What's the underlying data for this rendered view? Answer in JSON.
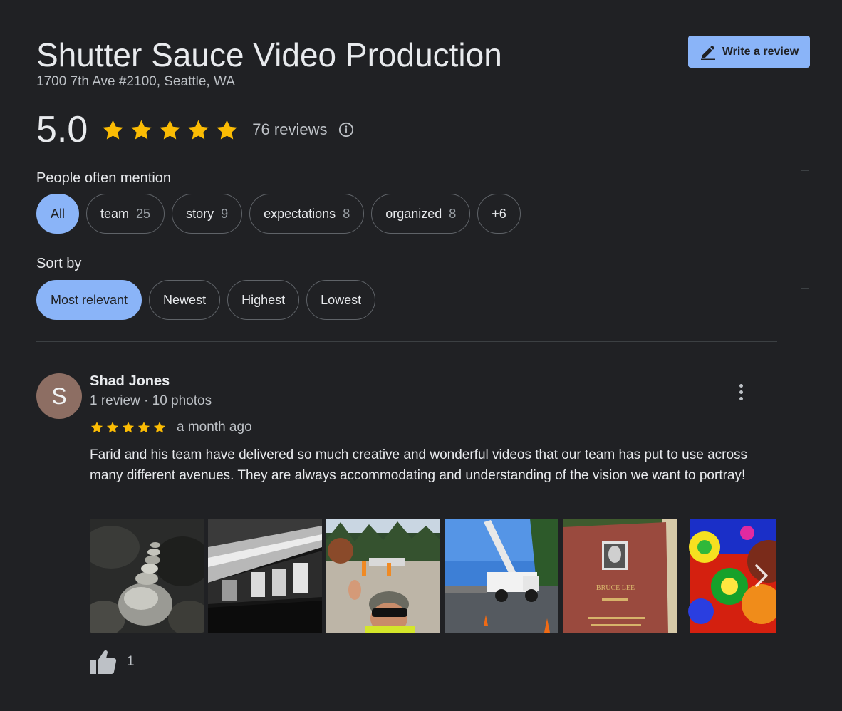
{
  "business": {
    "name": "Shutter Sauce Video Production",
    "address": "1700 7th Ave #2100, Seattle, WA"
  },
  "write_review": {
    "label": "Write a review",
    "icon": "pencil-icon"
  },
  "rating": {
    "value": "5.0",
    "stars": 5,
    "reviews_label": "76 reviews",
    "info_icon": "info-icon"
  },
  "mentions": {
    "label": "People often mention",
    "chips": [
      {
        "label": "All",
        "count": ""
      },
      {
        "label": "team",
        "count": "25"
      },
      {
        "label": "story",
        "count": "9"
      },
      {
        "label": "expectations",
        "count": "8"
      },
      {
        "label": "organized",
        "count": "8"
      },
      {
        "label": "+6",
        "count": ""
      }
    ]
  },
  "sort": {
    "label": "Sort by",
    "options": [
      "Most relevant",
      "Newest",
      "Highest",
      "Lowest"
    ],
    "selected": "Most relevant"
  },
  "review": {
    "avatar_letter": "S",
    "name": "Shad Jones",
    "meta": "1 review · 10 photos",
    "stars": 5,
    "date": "a month ago",
    "text": "Farid and his team have delivered so much creative and wonderful videos that our team has put to use across many different avenues.  They are always accommodating and understanding of the vision we want to portray!",
    "likes": "1",
    "photo_sign_text": [
      "BRUCE LEE"
    ]
  },
  "colors": {
    "background": "#202124",
    "accent": "#8ab4f8",
    "star": "#fbbc04",
    "avatar": "#8d6e63"
  }
}
